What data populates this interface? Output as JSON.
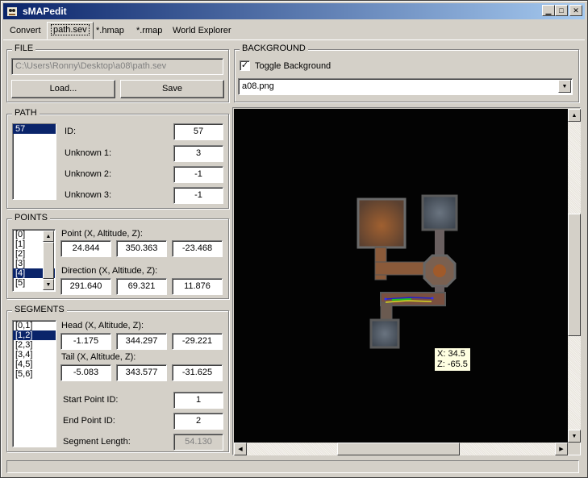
{
  "window": {
    "title": "sMAPedit"
  },
  "tabs": [
    "Convert",
    "path.sev",
    "*.hmap",
    "*.rmap",
    "World Explorer"
  ],
  "file": {
    "group_title": "FILE",
    "path": "C:\\Users\\Ronny\\Desktop\\a08\\path.sev",
    "load_label": "Load...",
    "save_label": "Save"
  },
  "background": {
    "group_title": "BACKGROUND",
    "toggle_label": "Toggle Background",
    "toggle_checked": true,
    "selected": "a08.png"
  },
  "path": {
    "group_title": "PATH",
    "list": [
      "57"
    ],
    "id_label": "ID:",
    "id_value": "57",
    "unk1_label": "Unknown 1:",
    "unk1_value": "3",
    "unk2_label": "Unknown 2:",
    "unk2_value": "-1",
    "unk3_label": "Unknown 3:",
    "unk3_value": "-1"
  },
  "points": {
    "group_title": "POINTS",
    "list": [
      "[0]",
      "[1]",
      "[2]",
      "[3]",
      "[4]",
      "[5]"
    ],
    "selected_index": 4,
    "point_label": "Point (X, Altitude, Z):",
    "point": [
      "24.844",
      "350.363",
      "-23.468"
    ],
    "direction_label": "Direction (X, Altitude, Z):",
    "direction": [
      "291.640",
      "69.321",
      "11.876"
    ]
  },
  "segments": {
    "group_title": "SEGMENTS",
    "list": [
      "[0,1]",
      "[1,2]",
      "[2,3]",
      "[3,4]",
      "[4,5]",
      "[5,6]"
    ],
    "selected_index": 1,
    "head_label": "Head (X, Altitude, Z):",
    "head": [
      "-1.175",
      "344.297",
      "-29.221"
    ],
    "tail_label": "Tail (X, Altitude, Z):",
    "tail": [
      "-5.083",
      "343.577",
      "-31.625"
    ],
    "start_label": "Start Point ID:",
    "start_value": "1",
    "end_label": "End Point ID:",
    "end_value": "2",
    "length_label": "Segment Length:",
    "length_value": "54.130"
  },
  "map": {
    "tooltip_x": "X: 34.5",
    "tooltip_z": "Z: -65.5"
  },
  "icons": {
    "app": "sheep-icon",
    "minimize": "minimize-icon",
    "maximize": "maximize-icon",
    "close": "close-icon",
    "dropdown": "chevron-down-icon",
    "scroll_up": "arrow-up-icon",
    "scroll_down": "arrow-down-icon",
    "scroll_left": "arrow-left-icon",
    "scroll_right": "arrow-right-icon",
    "check": "checkmark-icon"
  },
  "colors": {
    "titlebar": "#0a246a",
    "selection": "#0a246a",
    "tooltip": "#ffffe1"
  }
}
